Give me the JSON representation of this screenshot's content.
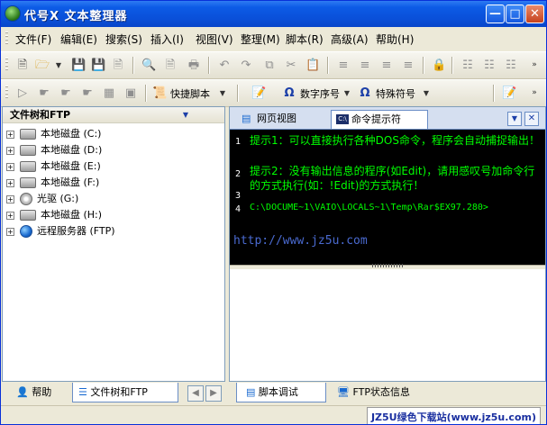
{
  "window": {
    "title": "代号X 文本整理器"
  },
  "menu": [
    "文件(F)",
    "编辑(E)",
    "搜索(S)",
    "插入(I)",
    "视图(V)",
    "整理(M)",
    "脚本(R)",
    "高级(A)",
    "帮助(H)"
  ],
  "toolbar2": {
    "script_label": "快捷脚本",
    "char_index_label": "数字序号",
    "special_char_label": "特殊符号"
  },
  "left_panel": {
    "title": "文件树和FTP",
    "tree": [
      "本地磁盘 (C:)",
      "本地磁盘 (D:)",
      "本地磁盘 (E:)",
      "本地磁盘 (F:)",
      "光驱 (G:)",
      "本地磁盘 (H:)",
      "远程服务器 (FTP)"
    ]
  },
  "right_panel": {
    "tabs": [
      "网页视图",
      "命令提示符"
    ],
    "console": [
      {
        "num": "1",
        "text": "提示1：可以直接执行各种DOS命令，程序会自动捕捉输出！"
      },
      {
        "num": "2",
        "text": "提示2：没有输出信息的程序(如Edit)，请用感叹号加命令行的方式执行(如：!Edit)的方式执行！"
      },
      {
        "num": "3",
        "text": ""
      },
      {
        "num": "4",
        "text": "C:\\DOCUME~1\\VAIO\\LOCALS~1\\Temp\\Rar$EX97.280>"
      }
    ],
    "watermark": "http://www.jz5u.com"
  },
  "bottom_left_tabs": [
    "帮助",
    "文件树和FTP"
  ],
  "bottom_right_tabs": [
    "脚本调试",
    "FTP状态信息"
  ],
  "status": {
    "watermark": "JZ5U绿色下载站(www.jz5u.com)"
  }
}
